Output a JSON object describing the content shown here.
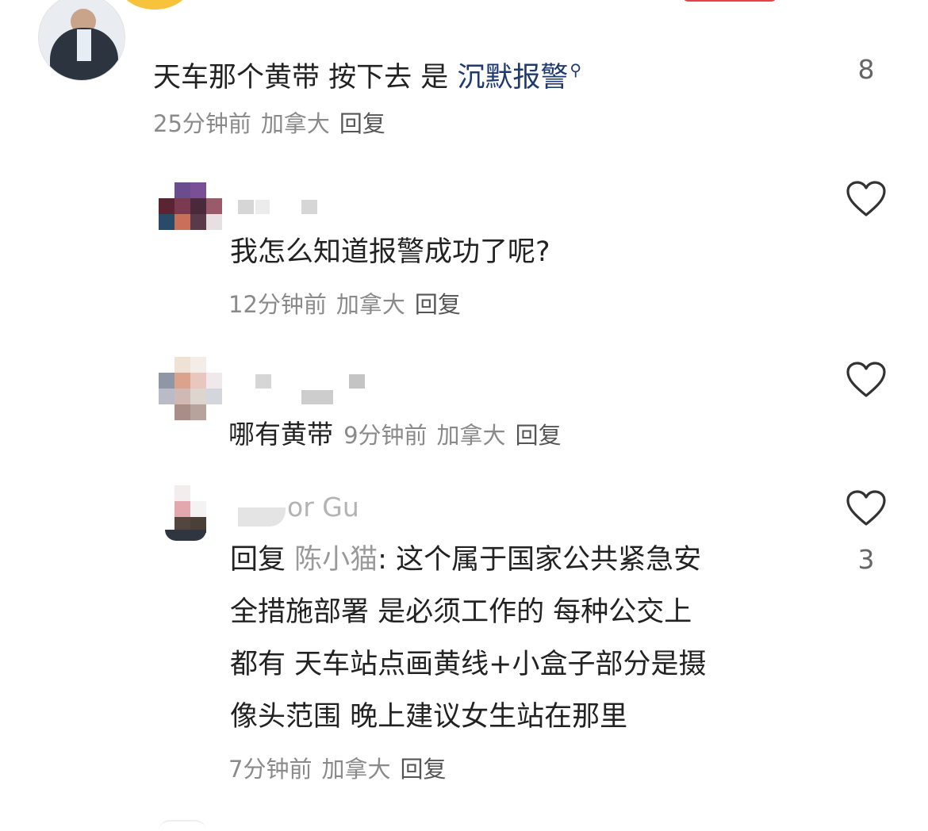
{
  "comments": [
    {
      "text": "天车那个黄带 按下去 是",
      "link_text": "沉默报警",
      "link_icon": "search-icon",
      "time": "25分钟前",
      "location": "加拿大",
      "reply_label": "回复",
      "like_count": "8"
    }
  ],
  "replies": [
    {
      "text": "我怎么知道报警成功了呢?",
      "time": "12分钟前",
      "location": "加拿大",
      "reply_label": "回复",
      "like_icon": "heart-icon"
    },
    {
      "text": "哪有黄带",
      "time": "9分钟前",
      "location": "加拿大",
      "reply_label": "回复",
      "like_icon": "heart-icon"
    },
    {
      "username_visible": "or Gu",
      "reply_prefix": "回复",
      "mention": "陈小猫",
      "lines": [
        ": 这个属于国家公共紧急安",
        "全措施部署 是必须工作的 每种公交上",
        "都有 天车站点画黄线+小盒子部分是摄",
        "像头范围 晚上建议女生站在那里"
      ],
      "time": "7分钟前",
      "location": "加拿大",
      "reply_label": "回复",
      "like_icon": "heart-icon",
      "like_count": "3"
    }
  ],
  "colors": {
    "link": "#1f3a6e",
    "meta": "#8a8a8a",
    "text": "#222222",
    "icon": "#333333"
  }
}
